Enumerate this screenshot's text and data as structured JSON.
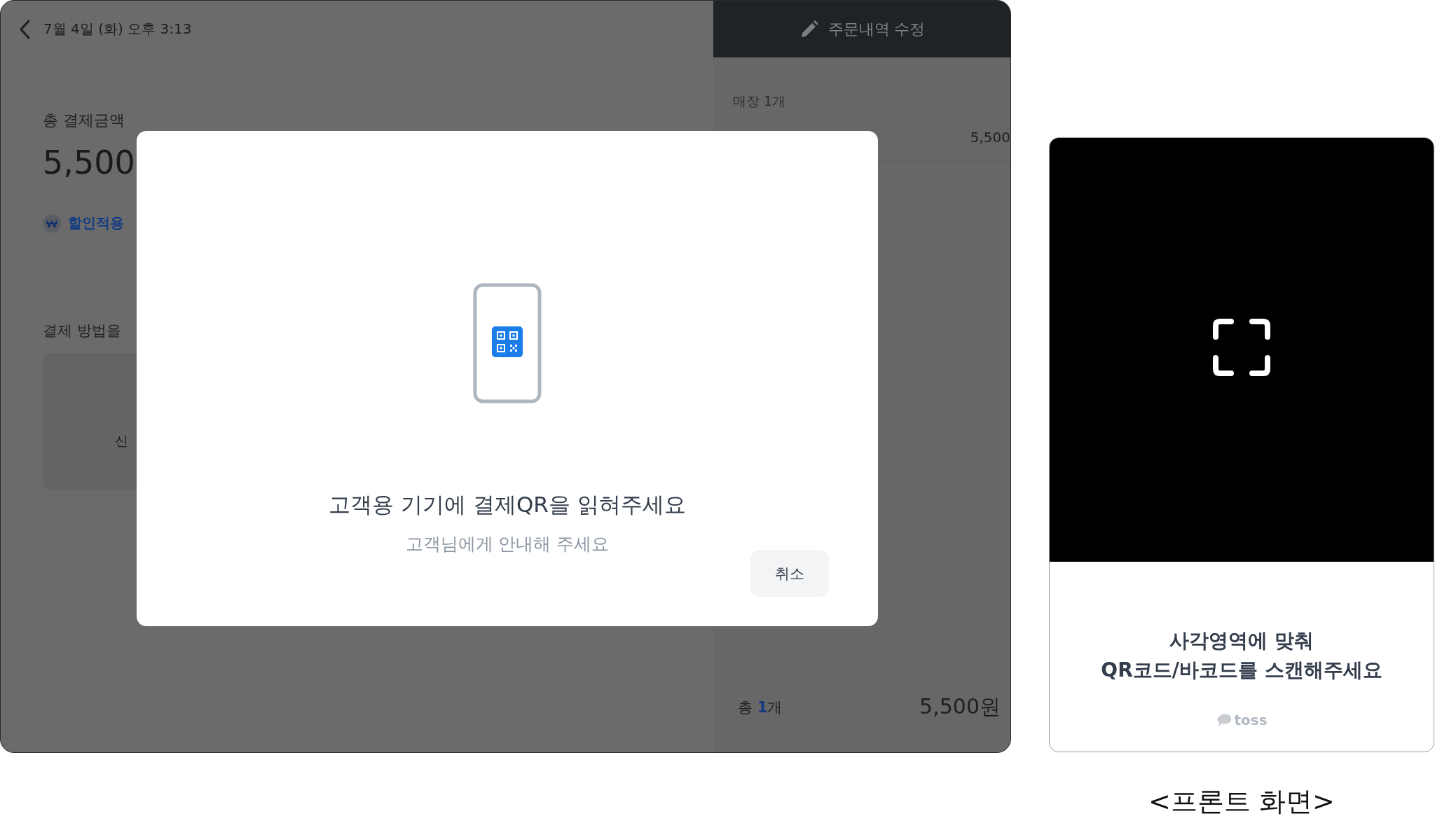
{
  "pos_screen": {
    "header": {
      "datetime": "7월 4일 (화) 오후 3:13"
    },
    "total_label": "총 결제금액",
    "total_amount": "5,500",
    "discount_chip": "할인적용",
    "payment_method_heading": "결제 방법을",
    "payment_option": "신",
    "order_panel": {
      "title": "주문내역 수정",
      "group_label": "매장 1개",
      "item_price": "5,500",
      "total_prefix": "총",
      "total_count": "1",
      "total_suffix": "개",
      "total_amount": "5,500원"
    }
  },
  "modal": {
    "title": "고객용 기기에 결제QR을 읽혀주세요",
    "subtitle": "고객님에게 안내해 주세요",
    "cancel_button": "취소"
  },
  "front_screen": {
    "instruction_lines": [
      "사각영역에 맞춰",
      "QR코드/바코드를 스캔해주세요"
    ],
    "brand": "toss"
  },
  "caption": "<프론트 화면>"
}
